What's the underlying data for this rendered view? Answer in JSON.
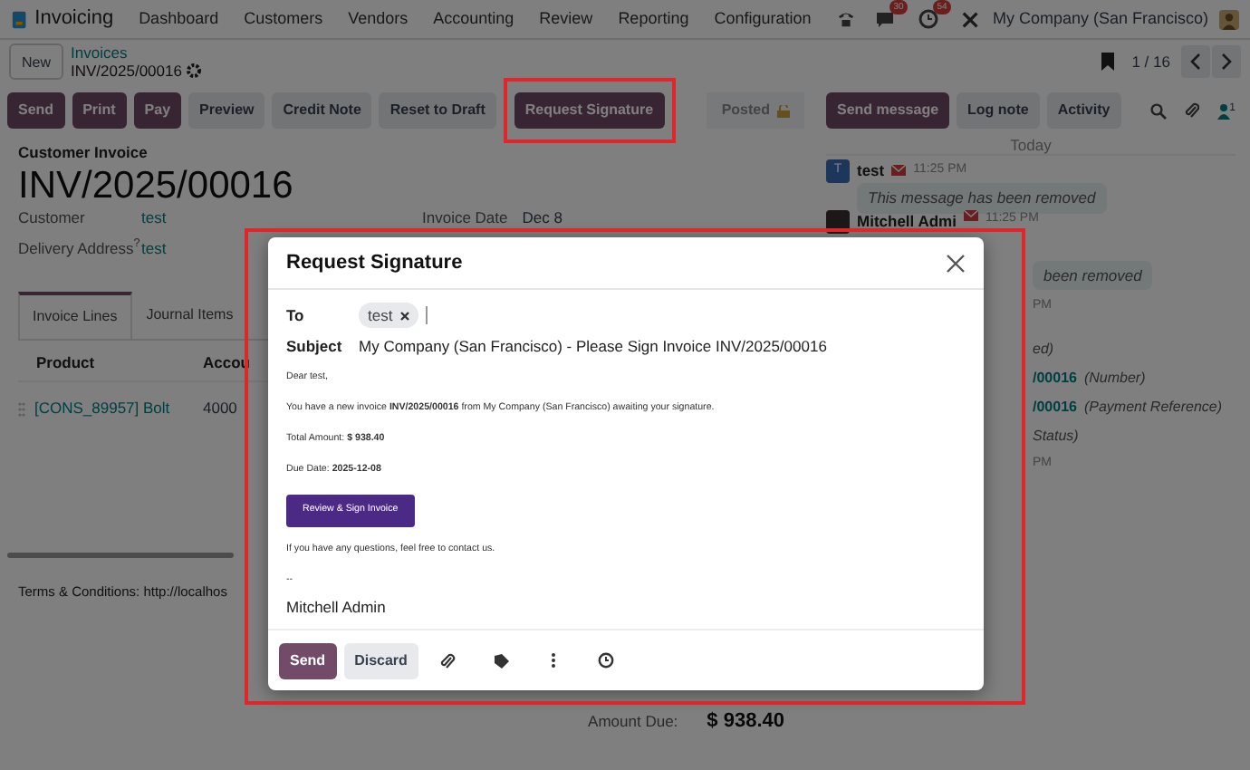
{
  "navbar": {
    "app": "Invoicing",
    "menu": [
      "Dashboard",
      "Customers",
      "Vendors",
      "Accounting",
      "Review",
      "Reporting",
      "Configuration"
    ],
    "chat_count": "30",
    "activity_count": "54",
    "company": "My Company (San Francisco)"
  },
  "control_panel": {
    "new_button": "New",
    "breadcrumb": "Invoices",
    "record": "INV/2025/00016",
    "pager": "1 / 16"
  },
  "actions": [
    {
      "label": "Send",
      "primary": true,
      "highlighted": false
    },
    {
      "label": "Print",
      "primary": true,
      "highlighted": false
    },
    {
      "label": "Pay",
      "primary": true,
      "highlighted": false
    },
    {
      "label": "Preview",
      "primary": false,
      "highlighted": false
    },
    {
      "label": "Credit Note",
      "primary": false,
      "highlighted": false
    },
    {
      "label": "Reset to Draft",
      "primary": false,
      "highlighted": false
    },
    {
      "label": "Request Signature",
      "primary": true,
      "highlighted": true
    }
  ],
  "status": "Posted",
  "form": {
    "type_label": "Customer Invoice",
    "number": "INV/2025/00016",
    "fields": [
      {
        "label": "Customer",
        "value": "test"
      },
      {
        "label": "Delivery Address$^{?}$",
        "value": "test"
      }
    ],
    "invoice_date": {
      "label": "Invoice Date",
      "value": "Dec 8"
    },
    "tabs": [
      {
        "label": "Invoice Lines",
        "selected": true
      },
      {
        "label": "Journal Items",
        "selected": false
      }
    ],
    "columns": [
      "Product",
      "Accou"
    ],
    "rows": [
      {
        "product": "[CONS_89957] Bolt",
        "column_2": "4000"
      }
    ],
    "terms": "Terms & Conditions: http://localhos",
    "amount_due_label": "Amount Due:",
    "amount_due": "$ 938.40"
  },
  "chatter": {
    "buttons": [
      {
        "label": "Send message",
        "primary": true
      },
      {
        "label": "Log note",
        "primary": false
      },
      {
        "label": "Activity",
        "primary": false
      }
    ],
    "followers": "1",
    "day": "Today",
    "messages": [
      {
        "initial": "T",
        "author": "test",
        "time": "11:25 PM",
        "body": "This message has been removed"
      },
      {
        "author": "Mitchell Admi",
        "time": "11:25 PM"
      }
    ],
    "fragments": [
      {
        "kind": "bubble",
        "text": "been removed"
      },
      {
        "kind": "time",
        "text": "PM"
      },
      {
        "kind": "note",
        "text": "ed)"
      },
      {
        "kind": "change",
        "link": "/00016",
        "note": "(Number)"
      },
      {
        "kind": "change",
        "link": "/00016",
        "note": "(Payment Reference)"
      },
      {
        "kind": "note",
        "text": "Status)"
      },
      {
        "kind": "time",
        "text": "PM"
      }
    ]
  },
  "dialog": {
    "title": "Request Signature",
    "to_label": "To",
    "recipients": [
      "test"
    ],
    "subject_label": "Subject",
    "subject": "My Company (San Francisco) - Please Sign Invoice INV/2025/00016",
    "body": [
      {
        "kind": "text",
        "text": "Dear test,"
      },
      {
        "kind": "text",
        "text": "You have a new invoice **INV/2025/00016** from My Company (San Francisco) awaiting your signature."
      },
      {
        "kind": "text",
        "text": "Total Amount: **$ 938.40**"
      },
      {
        "kind": "text",
        "text": "Due Date: **2025-12-08**"
      },
      {
        "kind": "button",
        "text": "Review & Sign Invoice"
      },
      {
        "kind": "text",
        "text": "If you have any questions, feel free to contact us."
      },
      {
        "kind": "text",
        "text": "--"
      },
      {
        "kind": "signature",
        "text": "Mitchell Admin"
      }
    ],
    "send": "Send",
    "discard": "Discard"
  }
}
